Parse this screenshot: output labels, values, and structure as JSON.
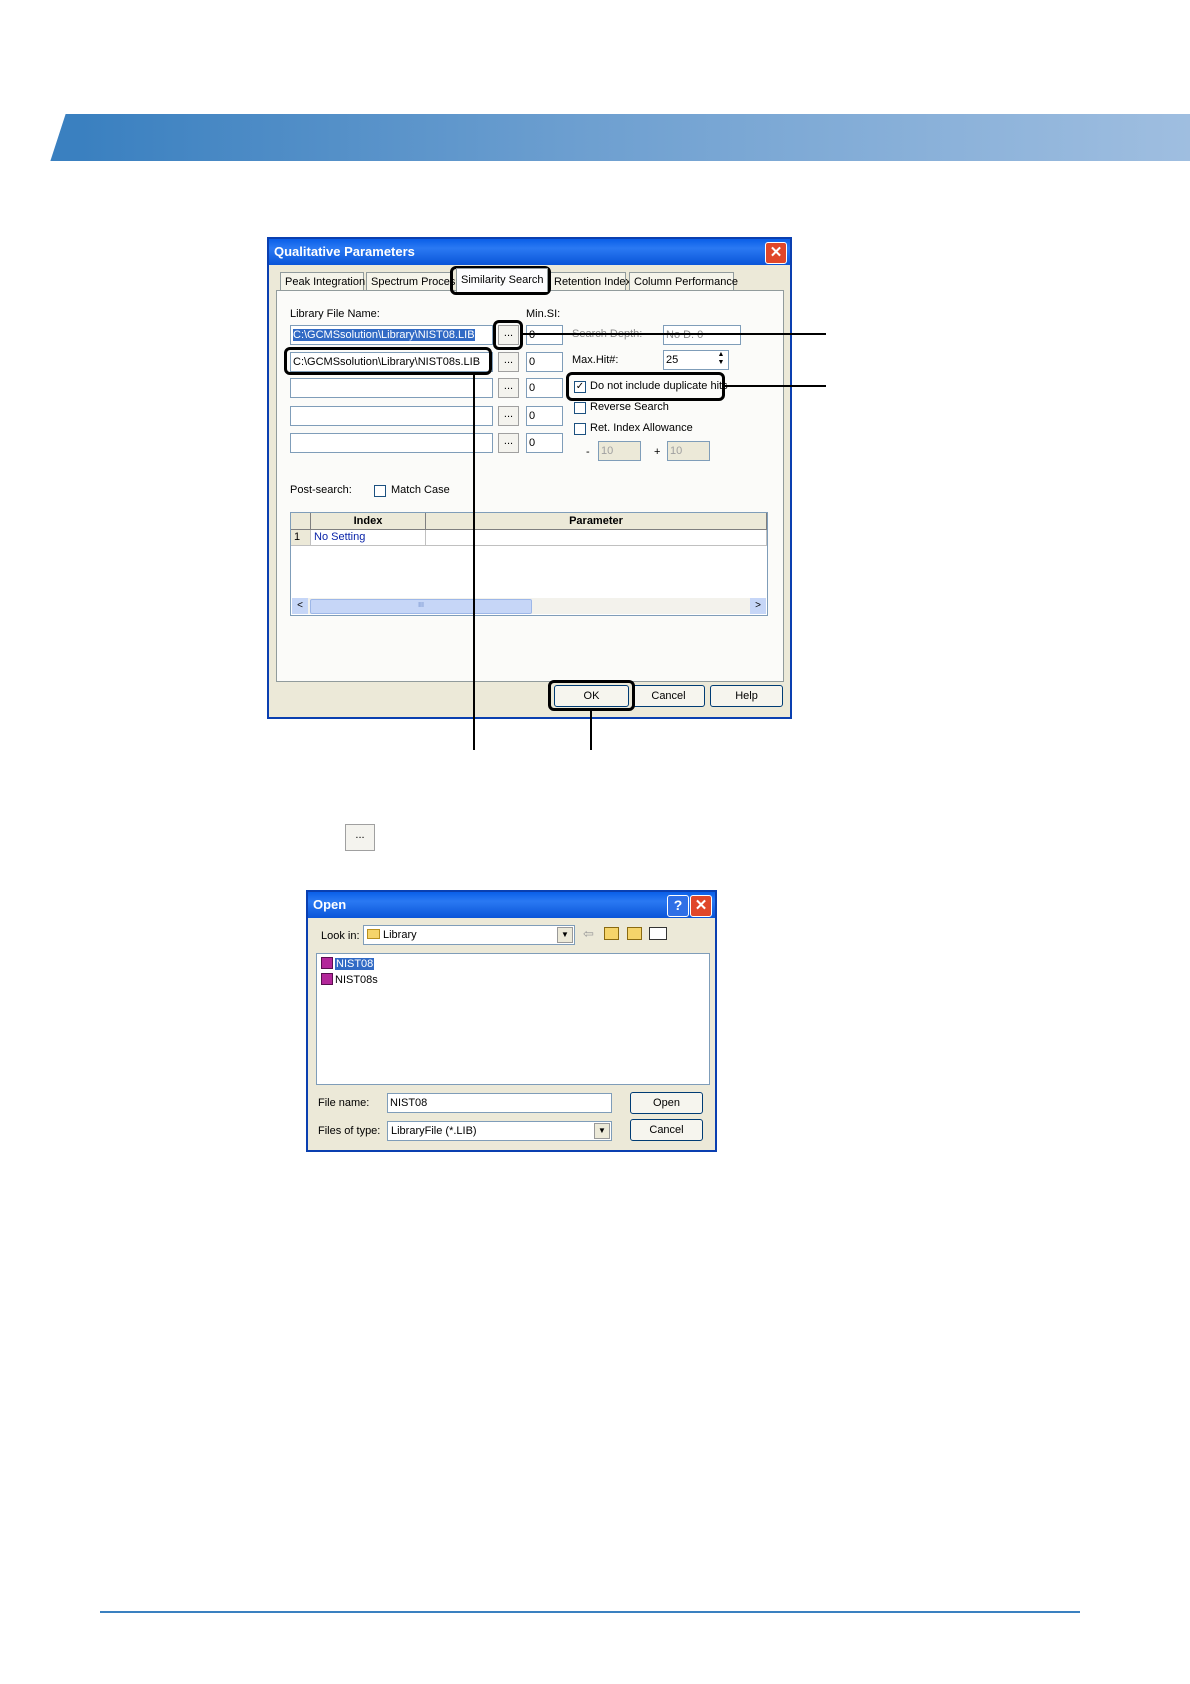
{
  "qualitative_dialog": {
    "title": "Qualitative Parameters",
    "close_glyph": "✕",
    "tabs": [
      "Peak Integration",
      "Spectrum Proces:",
      "Similarity Search",
      "Retention Index",
      "Column Performance"
    ],
    "library_label": "Library File Name:",
    "library_files": [
      "C:\\GCMSsolution\\Library\\NIST08.LIB",
      "C:\\GCMSsolution\\Library\\NIST08s.LIB",
      "",
      "",
      ""
    ],
    "browse_label": "...",
    "min_si_label": "Min.SI:",
    "min_si_values": [
      "0",
      "0",
      "0",
      "0",
      "0"
    ],
    "search_depth_label": "Search Depth:",
    "search_depth_value": "No D. 0",
    "max_hits_label": "Max.Hit#:",
    "max_hits_value": "25",
    "no_duplicates_label": "Do not include duplicate hits",
    "no_duplicates_checked": true,
    "reverse_search_label": "Reverse Search",
    "reverse_search_checked": false,
    "ret_index_label": "Ret. Index Allowance",
    "ret_index_checked": false,
    "ret_minus_sign": "-",
    "ret_minus_value": "10",
    "ret_plus_sign": "+",
    "ret_plus_value": "10",
    "post_search_label": "Post-search:",
    "match_case_label": "Match Case",
    "match_case_checked": false,
    "grid": {
      "headers": [
        "",
        "Index",
        "Parameter"
      ],
      "rows": [
        [
          "1",
          "No Setting",
          ""
        ]
      ]
    },
    "scroll_left": "<",
    "scroll_mid": "III",
    "scroll_right": ">",
    "buttons": {
      "ok": "OK",
      "cancel": "Cancel",
      "help": "Help"
    }
  },
  "standalone_browse_button": "...",
  "open_dialog": {
    "title": "Open",
    "help_glyph": "?",
    "close_glyph": "✕",
    "look_in_label": "Look in:",
    "look_in_value": "Library",
    "files": [
      "NIST08",
      "NIST08s"
    ],
    "file_name_label": "File name:",
    "file_name_value": "NIST08",
    "files_of_type_label": "Files of type:",
    "files_of_type_value": "LibraryFile (*.LIB)",
    "open_button": "Open",
    "cancel_button": "Cancel"
  },
  "colors": {
    "banner_start": "#3a80c0",
    "banner_end": "#9fbee0",
    "xp_title": "#0a5fe8",
    "selection": "#316ac5"
  }
}
